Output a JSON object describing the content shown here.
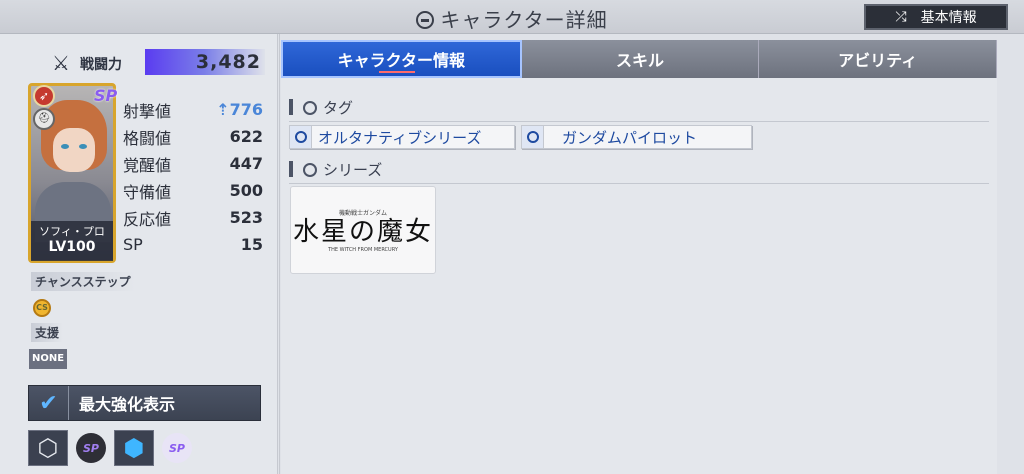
{
  "header": {
    "title": "キャラクター詳細",
    "basic_info_label": "基本情報"
  },
  "power": {
    "label": "戦闘力",
    "value": "3,482"
  },
  "character": {
    "name": "ソフィ・プロ",
    "level": "LV100",
    "sp_badge": "SP",
    "type_badge": "⛑"
  },
  "stats": [
    {
      "label": "射撃値",
      "value": "776"
    },
    {
      "label": "格闘値",
      "value": "622"
    },
    {
      "label": "覚醒値",
      "value": "447"
    },
    {
      "label": "守備値",
      "value": "500"
    },
    {
      "label": "反応値",
      "value": "523"
    },
    {
      "label": "SP",
      "value": "15"
    }
  ],
  "chance_step": {
    "label": "チャンスステップ",
    "badge": "CS"
  },
  "support": {
    "label": "支援",
    "value": "NONE"
  },
  "max_display": {
    "label": "最大強化表示"
  },
  "bottom_icons": {
    "sp1": "SP",
    "sp2": "SP"
  },
  "tabs": [
    {
      "label": "キャラクター情報",
      "active": true
    },
    {
      "label": "スキル",
      "active": false
    },
    {
      "label": "アビリティ",
      "active": false
    }
  ],
  "sections": {
    "tags_title": "タグ",
    "series_title": "シリーズ"
  },
  "tags": [
    "オルタナティブシリーズ",
    "ガンダムパイロット"
  ],
  "series": {
    "small": "機動戦士ガンダム",
    "logo": "水星の魔女",
    "sub": "THE WITCH FROM MERCURY"
  },
  "colors": {
    "accent": "#1a4fbf",
    "power_bar": "#5a3cf0",
    "stat_up": "#4a86d8",
    "frame_gold": "#d8a52c"
  }
}
